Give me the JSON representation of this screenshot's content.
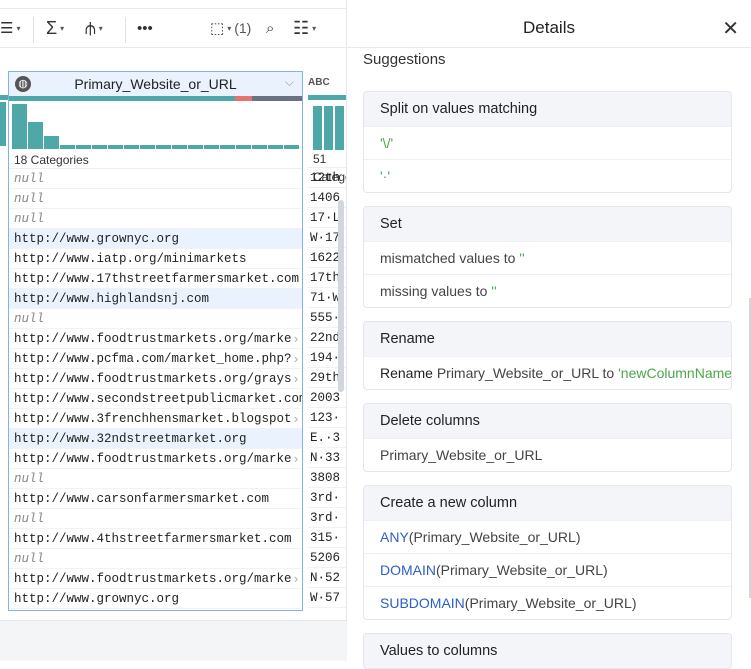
{
  "toolbar": {
    "selection_count": "(1)"
  },
  "column": {
    "name": "Primary_Website_or_URL",
    "type_icon": "globe-icon",
    "categories": "18 Categories",
    "quality": {
      "valid": 0.77,
      "mismatched": 0.06,
      "missing": 0.17
    },
    "histogram": [
      10,
      6,
      3,
      1,
      1,
      1,
      1,
      1,
      1,
      1,
      1,
      1,
      1,
      1,
      1,
      1,
      1,
      1
    ],
    "rows": [
      {
        "v": "null",
        "null": true
      },
      {
        "v": "null",
        "null": true
      },
      {
        "v": "null",
        "null": true
      },
      {
        "v": "http://www.grownyc.org",
        "hl": true
      },
      {
        "v": "http://www.iatp.org/minimarkets"
      },
      {
        "v": "http://www.17thstreetfarmersmarket.com"
      },
      {
        "v": "http://www.highlandsnj.com",
        "hl": true
      },
      {
        "v": "null",
        "null": true
      },
      {
        "v": "http://www.foodtrustmarkets.org/marke",
        "more": true
      },
      {
        "v": "http://www.pcfma.com/market_home.php?",
        "more": true
      },
      {
        "v": "http://www.foodtrustmarkets.org/grays",
        "more": true
      },
      {
        "v": "http://www.secondstreetpublicmarket.com"
      },
      {
        "v": "http://www.3frenchhensmarket.blogspot",
        "more": true
      },
      {
        "v": "http://www.32ndstreetmarket.org",
        "hl": true
      },
      {
        "v": "http://www.foodtrustmarkets.org/marke",
        "more": true
      },
      {
        "v": "null",
        "null": true
      },
      {
        "v": "http://www.carsonfarmersmarket.com"
      },
      {
        "v": "null",
        "null": true
      },
      {
        "v": "http://www.4thstreetfarmersmarket.com"
      },
      {
        "v": "null",
        "null": true
      },
      {
        "v": "http://www.foodtrustmarkets.org/marke",
        "more": true
      },
      {
        "v": "http://www.grownyc.org"
      }
    ]
  },
  "next_column": {
    "type_label": "ABC",
    "categories": "51 Categories",
    "rows": [
      "12th",
      "1406",
      "17·L",
      "W·17",
      "1622",
      "17th",
      "71·W",
      "555·",
      "22nd",
      "194·",
      "29th",
      "2003",
      "123·",
      "E.·3",
      "N·33",
      "3808",
      "3rd·",
      "3rd·",
      "315·",
      "5206",
      "N·52",
      "W·57"
    ]
  },
  "panel": {
    "title": "Details",
    "suggestions_label": "Suggestions",
    "cards": [
      {
        "title": "Split on values matching",
        "items": [
          [
            {
              "t": "'\\/'",
              "c": "g"
            }
          ],
          [
            {
              "t": "'·'",
              "c": "g"
            }
          ]
        ]
      },
      {
        "title": "Set",
        "items": [
          [
            {
              "t": "mismatched values to ",
              "c": ""
            },
            {
              "t": "''",
              "c": "g"
            }
          ],
          [
            {
              "t": "missing values to ",
              "c": ""
            },
            {
              "t": "''",
              "c": "g"
            }
          ]
        ]
      },
      {
        "title": "Rename",
        "items": [
          [
            {
              "t": "Rename ",
              "c": "k"
            },
            {
              "t": "Primary_Website_or_URL to ",
              "c": ""
            },
            {
              "t": "'newColumnName'",
              "c": "g"
            }
          ]
        ]
      },
      {
        "title": "Delete columns",
        "items": [
          [
            {
              "t": "Primary_Website_or_URL",
              "c": ""
            }
          ]
        ]
      },
      {
        "title": "Create a new column",
        "items": [
          [
            {
              "t": "ANY",
              "c": "b"
            },
            {
              "t": "(Primary_Website_or_URL)",
              "c": ""
            }
          ],
          [
            {
              "t": "DOMAIN",
              "c": "b"
            },
            {
              "t": "(Primary_Website_or_URL)",
              "c": ""
            }
          ],
          [
            {
              "t": "SUBDOMAIN",
              "c": "b"
            },
            {
              "t": "(Primary_Website_or_URL)",
              "c": ""
            }
          ]
        ]
      },
      {
        "title": "Values to columns",
        "items": []
      }
    ]
  },
  "colors": {
    "teal": "#4fa8a8",
    "mismatch": "#e57373",
    "missing": "#6b7280",
    "green": "#4aa84a",
    "blue": "#2d5fc7"
  }
}
